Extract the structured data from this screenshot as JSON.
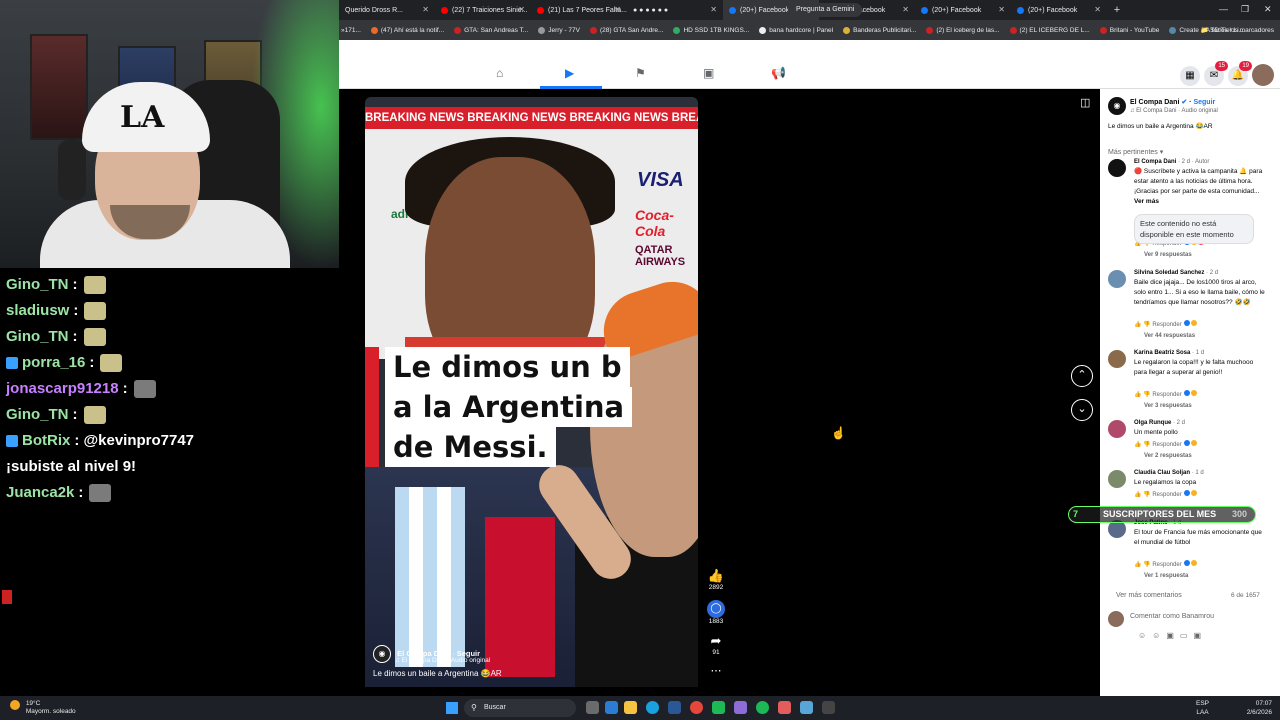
{
  "stream": {
    "chat": [
      {
        "user": "Gino_TN",
        "msg": ":",
        "color": "green",
        "emote": true
      },
      {
        "user": "sladiusw",
        "msg": ":",
        "color": "green",
        "emote": true
      },
      {
        "user": "Gino_TN",
        "msg": ":",
        "color": "green",
        "emote": true
      },
      {
        "user": "porra_16",
        "msg": ":",
        "color": "green",
        "emote": true,
        "badge": true
      },
      {
        "user": "jonascarp91218",
        "msg": ":",
        "color": "purple",
        "emote": "cat"
      },
      {
        "user": "Gino_TN",
        "msg": ":",
        "color": "green",
        "emote": true
      },
      {
        "user": "BotRix",
        "msg": ": @kevinpro7747",
        "color": "green",
        "badge": true
      },
      {
        "user": "",
        "msg": "¡subiste al nivel 9!",
        "color": "white"
      },
      {
        "user": "Juanca2k",
        "msg": ":",
        "color": "green",
        "emote": "cat"
      }
    ],
    "webcam_cap_logo": "LA",
    "subs": {
      "num": "7",
      "label": "SUSCRIPTORES DEL MES",
      "value": "300"
    }
  },
  "browser": {
    "tabs": [
      {
        "label": "Querido Dross R...",
        "icon": "none"
      },
      {
        "label": "(22) 7 Traiciones Sinie...",
        "icon": "yt"
      },
      {
        "label": "(21) Las 7 Peores Falta...",
        "icon": "yt"
      },
      {
        "label": "● ● ● ● ● ●",
        "icon": "none"
      },
      {
        "label": "(20+) Facebook",
        "icon": "fb",
        "active": true
      },
      {
        "label": "(20+) Facebook",
        "icon": "fb"
      },
      {
        "label": "(20+) Facebook",
        "icon": "fb"
      },
      {
        "label": "(20+) Facebook",
        "icon": "fb"
      }
    ],
    "new_tab": "+",
    "gemini_button": "Pregunta a Gemini",
    "bookmarks": [
      {
        "label": "(47) Ahí está la notif...",
        "color": "#e86a2c"
      },
      {
        "label": "GTA: San Andreas T...",
        "color": "#c22"
      },
      {
        "label": "Jerry - 77V",
        "color": "#999"
      },
      {
        "label": "(28) GTA San Andre...",
        "color": "#c22"
      },
      {
        "label": "HD SSD 1TB KINGS...",
        "color": "#3a6"
      },
      {
        "label": "bana hardcore | Panel",
        "color": "#eee"
      },
      {
        "label": "Banderas Publicitari...",
        "color": "#d9b13a"
      },
      {
        "label": "(2) El iceberg de las...",
        "color": "#c22"
      },
      {
        "label": "(2) EL ICEBERG DE L...",
        "color": "#c22"
      },
      {
        "label": "Britani - YouTube",
        "color": "#c22"
      },
      {
        "label": "Create a ASD Tier Li...",
        "color": "#58a"
      }
    ],
    "bookmarks_all": "Todos los marcadores",
    "bookmark_prefix": "»171..."
  },
  "facebook": {
    "notif_count": "15",
    "msg_count": "19",
    "reel": {
      "banner": "BREAKING NEWS   BREAKING NEWS   BREAKING NEWS   BREAKING NEWS",
      "caption_lines": [
        "Le dimos un b",
        "a la Argentina",
        "de Messi."
      ],
      "sponsors": [
        "VISA",
        "Coca-Cola",
        "QATAR AIRWAYS",
        "adidas"
      ],
      "author": "El Compa Dani",
      "follow": "Seguir",
      "audio": "♫ El Compa Dani · Audio original",
      "description": "Le dimos un baile a Argentina 😂AR",
      "likes": "2892",
      "comments": "1883",
      "shares": "91"
    },
    "side": {
      "author": "El Compa Dani",
      "follow": "Seguir",
      "audio": "♫ El Compa Dani · Audio original",
      "description": "Le dimos un baile a Argentina 😂AR",
      "sort": "Más pertinentes ▾",
      "comments": [
        {
          "name": "El Compa Dani",
          "time": "· 2 d · Autor",
          "text": "🔴 Suscríbete y activa la campanita 🔔 para estar atento a las noticias de última hora. ¡Gracias por ser parte de esta comunidad...",
          "link": "Ver más",
          "replies": "Ver 9 respuestas",
          "color": "#111"
        },
        {
          "name": "Silvina Soledad Sanchez",
          "time": "· 2 d",
          "text": "Baile dice jajaja... De los1000 tiros al arco, solo entro 1... Si a eso le llama baile, cómo le tendríamos que llamar nosotros?? 🤣🤣",
          "replies": "Ver 44 respuestas",
          "color": "#6b8fb0"
        },
        {
          "name": "Karina Beatriz Sosa",
          "time": "· 1 d",
          "text": "Le regalaron la copa!!! y le falta muchooo para llegar a superar al genio!!",
          "replies": "Ver 3 respuestas",
          "color": "#8a6a4a"
        },
        {
          "name": "Olga Runque",
          "time": "· 2 d",
          "text": "Un mente pollo",
          "replies": "Ver 2 respuestas",
          "color": "#b04a6a"
        },
        {
          "name": "Claudia Clau Soljan",
          "time": "· 1 d",
          "text": "Le regalamos la copa",
          "replies": "",
          "color": "#7a8a6a"
        },
        {
          "name": "Jose Patino",
          "time": "· 1 d",
          "text": "El tour de Francia fue más emocionante que el mundial de fútbol",
          "replies": "Ver 1 respuesta",
          "color": "#5a6a8a"
        }
      ],
      "reply_label": "Responder",
      "unavailable": "Este contenido no está disponible en este momento",
      "more_comments": "Ver más comentarios",
      "count": "6 de 1657",
      "compose_placeholder": "Comentar como Banamrou"
    }
  },
  "taskbar": {
    "weather_temp": "19°C",
    "weather_desc": "Mayorm. soleado",
    "search": "Buscar",
    "lang": "ESP",
    "lang2": "LAA",
    "time": "07:07",
    "date": "2/6/2026"
  },
  "colors": {
    "fb_blue": "#1877f2",
    "breaking_red": "#d91f2a",
    "chat_green": "#9be4a6",
    "chat_purple": "#c780ff"
  }
}
